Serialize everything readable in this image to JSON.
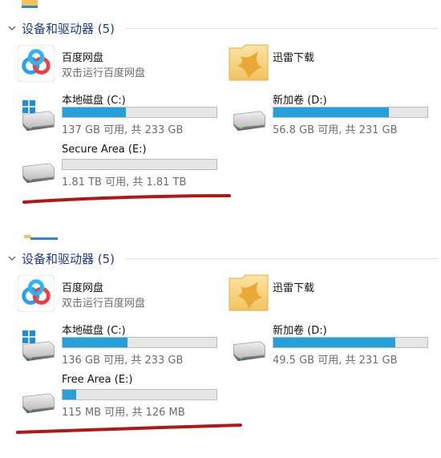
{
  "colors": {
    "accent_fill": "#26a0da",
    "bar_track": "#e6e6e6",
    "header_text": "#1e3b8f",
    "annotation": "#b01818"
  },
  "panels": [
    {
      "header": {
        "title": "设备和驱动器 (5)"
      },
      "apps": [
        {
          "name": "百度网盘",
          "subtitle": "双击运行百度网盘",
          "icon": "baidu-netdisk-icon"
        },
        {
          "name": "迅雷下载",
          "icon": "xunlei-folder-icon"
        }
      ],
      "drives": [
        {
          "name": "本地磁盘 (C:)",
          "space": "137 GB 可用, 共 233 GB",
          "used_percent": 41,
          "icon": "windows-drive-icon"
        },
        {
          "name": "新加卷 (D:)",
          "space": "56.8 GB 可用, 共 231 GB",
          "used_percent": 75,
          "icon": "drive-icon"
        },
        {
          "name": "Secure Area (E:)",
          "space": "1.81 TB 可用, 共 1.81 TB",
          "used_percent": 0,
          "icon": "drive-icon"
        }
      ]
    },
    {
      "header": {
        "title": "设备和驱动器 (5)"
      },
      "apps": [
        {
          "name": "百度网盘",
          "subtitle": "双击运行百度网盘",
          "icon": "baidu-netdisk-icon"
        },
        {
          "name": "迅雷下载",
          "icon": "xunlei-folder-icon"
        }
      ],
      "drives": [
        {
          "name": "本地磁盘 (C:)",
          "space": "136 GB 可用, 共 233 GB",
          "used_percent": 42,
          "icon": "windows-drive-icon"
        },
        {
          "name": "新加卷 (D:)",
          "space": "49.5 GB 可用, 共 231 GB",
          "used_percent": 79,
          "icon": "drive-icon"
        },
        {
          "name": "Free Area (E:)",
          "space": "115 MB 可用, 共 126 MB",
          "used_percent": 9,
          "icon": "drive-icon"
        }
      ]
    }
  ]
}
